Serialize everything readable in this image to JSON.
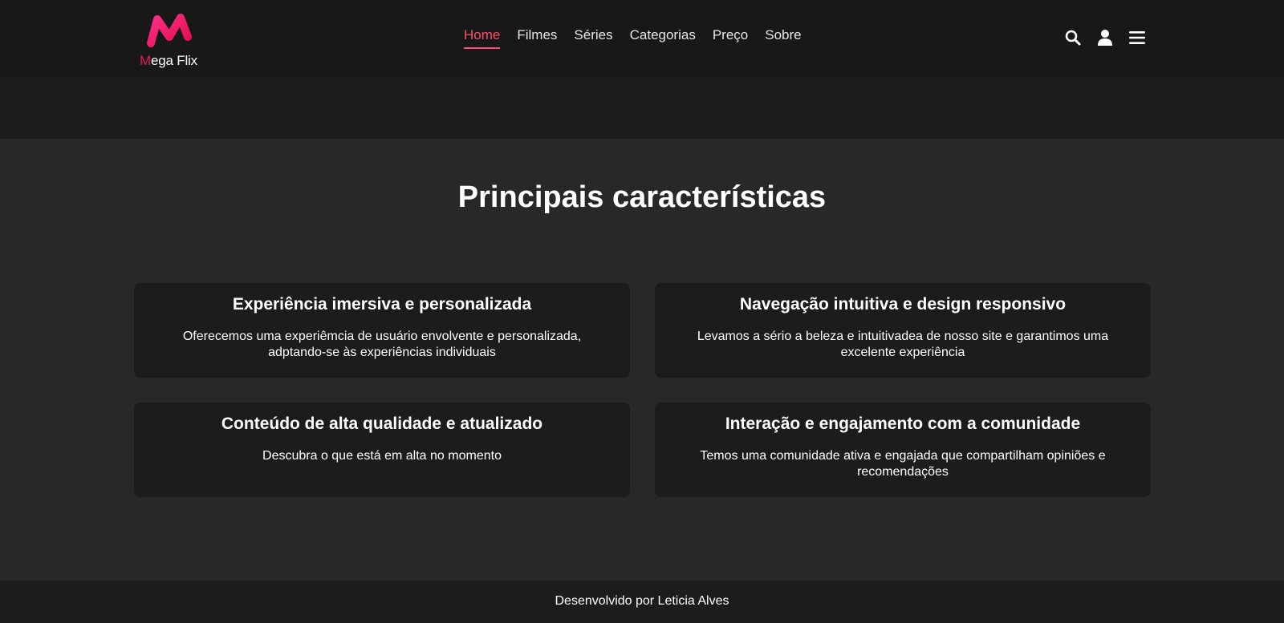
{
  "header": {
    "logo": {
      "first_letter": "M",
      "rest": "ega Flix",
      "brand_color": "#e8175d",
      "icon": "mega-flix-logo-icon"
    },
    "nav": [
      {
        "label": "Home",
        "active": true
      },
      {
        "label": "Filmes",
        "active": false
      },
      {
        "label": "Séries",
        "active": false
      },
      {
        "label": "Categorias",
        "active": false
      },
      {
        "label": "Preço",
        "active": false
      },
      {
        "label": "Sobre",
        "active": false
      }
    ],
    "active_color": "#ff4d6d",
    "icons": [
      "search-icon",
      "user-icon",
      "menu-icon"
    ]
  },
  "features": {
    "title": "Principais características",
    "cards": [
      {
        "title": "Experiência imersiva e personalizada",
        "text": "Oferecemos uma experiêmcia de usuário envolvente e personalizada, adptando-se às experiências individuais"
      },
      {
        "title": "Navegação intuitiva e design responsivo",
        "text": "Levamos a sério a beleza e intuitivadea de nosso site e garantimos uma excelente experiência"
      },
      {
        "title": "Conteúdo de alta qualidade e atualizado",
        "text": "Descubra o que está em alta no momento"
      },
      {
        "title": "Interação e engajamento com a comunidade",
        "text": "Temos uma comunidade ativa e engajada que compartilham opiniões e recomendações"
      }
    ]
  },
  "footer": {
    "text": "Desenvolvido por Leticia Alves"
  }
}
